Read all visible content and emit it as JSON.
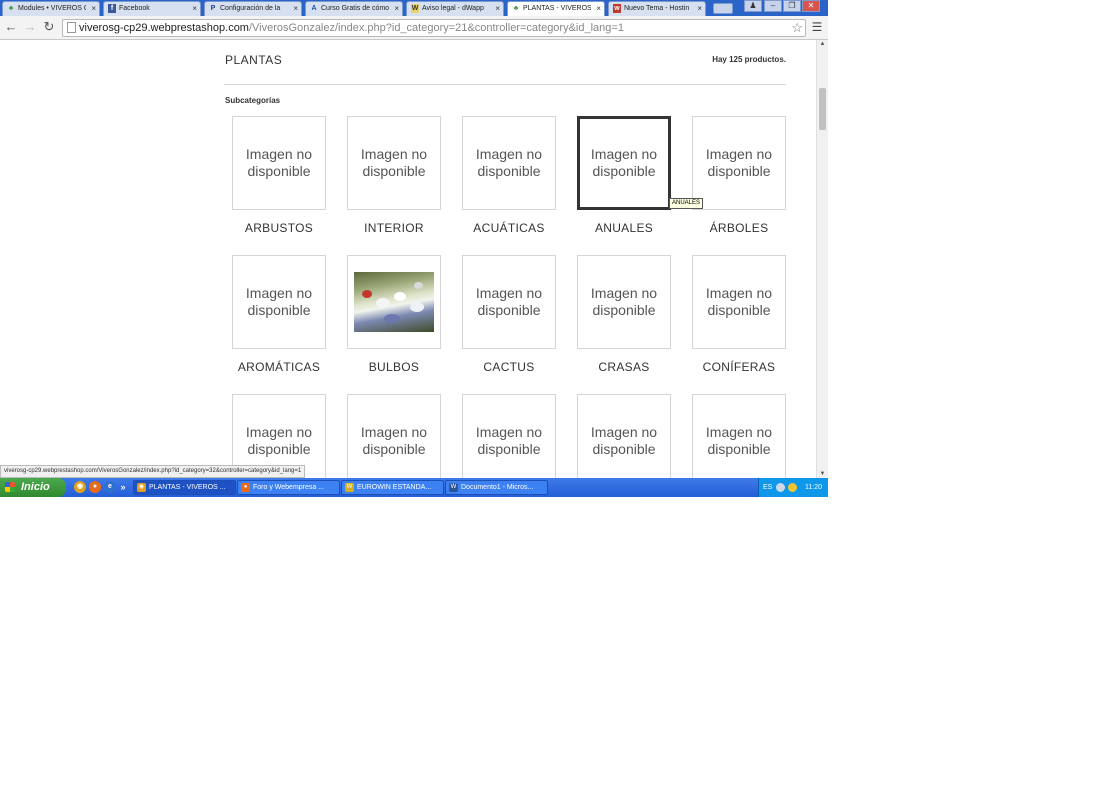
{
  "browser": {
    "tabs": [
      {
        "label": "Modules • VIVEROS G",
        "favicon": "prestashop-icon",
        "active": false
      },
      {
        "label": "Facebook",
        "favicon": "facebook-icon",
        "active": false
      },
      {
        "label": "Configuración de la",
        "favicon": "paypal-icon",
        "active": false
      },
      {
        "label": "Curso Gratis de cómo",
        "favicon": "aulaclic-icon",
        "active": false
      },
      {
        "label": "Aviso legal - dWapp",
        "favicon": "page-icon",
        "active": false
      },
      {
        "label": "PLANTAS - VIVEROS",
        "favicon": "prestashop-icon",
        "active": true
      },
      {
        "label": "Nuevo Tema - Hostin",
        "favicon": "webempresa-icon",
        "active": false
      }
    ],
    "tab_close_glyph": "×",
    "address": {
      "host": "viverosg-cp29.webprestashop.com",
      "path": "/ViverosGonzalez/index.php?id_category=21&controller=category&id_lang=1"
    },
    "status_url": "viverosg-cp29.webprestashop.com/ViverosGonzalez/index.php?id_category=32&controller=category&id_lang=1"
  },
  "page": {
    "category_title": "PLANTAS",
    "product_count": "Hay 125 productos.",
    "subcategories_heading": "Subcategorías",
    "tooltip": "ANUALES",
    "subcategories": [
      {
        "name": "ARBUSTOS",
        "image_text": "Imagen no disponible",
        "has_photo": false
      },
      {
        "name": "INTERIOR",
        "image_text": "Imagen no disponible",
        "has_photo": false
      },
      {
        "name": "ACUÁTICAS",
        "image_text": "Imagen no disponible",
        "has_photo": false
      },
      {
        "name": "ANUALES",
        "image_text": "Imagen no disponible",
        "has_photo": false,
        "hovered": true
      },
      {
        "name": "ÁRBOLES",
        "image_text": "Imagen no disponible",
        "has_photo": false
      },
      {
        "name": "AROMÁTICAS",
        "image_text": "Imagen no disponible",
        "has_photo": false
      },
      {
        "name": "BULBOS",
        "image_text": "",
        "has_photo": true
      },
      {
        "name": "CACTUS",
        "image_text": "Imagen no disponible",
        "has_photo": false
      },
      {
        "name": "CRASAS",
        "image_text": "Imagen no disponible",
        "has_photo": false
      },
      {
        "name": "CONÍFERAS",
        "image_text": "Imagen no disponible",
        "has_photo": false
      },
      {
        "name": "",
        "image_text": "Imagen no disponible",
        "has_photo": false
      },
      {
        "name": "",
        "image_text": "Imagen no disponible",
        "has_photo": false
      },
      {
        "name": "",
        "image_text": "Imagen no disponible",
        "has_photo": false
      },
      {
        "name": "",
        "image_text": "Imagen no disponible",
        "has_photo": false
      },
      {
        "name": "",
        "image_text": "Imagen no disponible",
        "has_photo": false
      }
    ]
  },
  "taskbar": {
    "start_label": "Inicio",
    "quick_launch_more": "»",
    "windows": [
      {
        "label": "PLANTAS - VIVEROS ...",
        "icon": "chrome-icon",
        "active": true
      },
      {
        "label": "Foro y  Webempresa ...",
        "icon": "firefox-icon",
        "active": false
      },
      {
        "label": "EUROWIN ESTANDA...",
        "icon": "eurowin-icon",
        "active": false
      },
      {
        "label": "Documento1 - Micros...",
        "icon": "word-icon",
        "active": false
      }
    ],
    "tray": {
      "language": "ES",
      "clock": "11:20"
    }
  },
  "colors": {
    "xp_taskbar": "#245ed6",
    "start_button": "#2f8a2f",
    "tab_strip": "#2a64c9",
    "card_border": "#d6d4d4",
    "hover_border": "#333333"
  }
}
